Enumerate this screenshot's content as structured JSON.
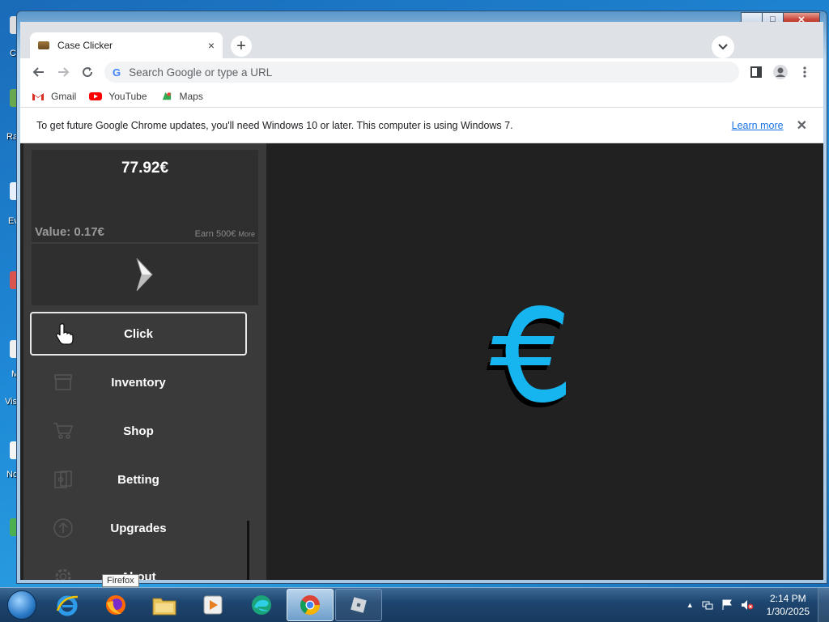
{
  "desktop": {
    "edge_labels": [
      "C",
      "Ra",
      "Ev",
      "M",
      "Vis",
      "No"
    ]
  },
  "browser": {
    "tab_title": "Case Clicker",
    "tab_close": "×",
    "new_tab": "+",
    "tab_search": "⌄",
    "omnibox_placeholder": "Search Google or type a URL",
    "bookmarks": [
      {
        "label": "Gmail",
        "color": "#d93025"
      },
      {
        "label": "YouTube",
        "color": "#ff0000"
      },
      {
        "label": "Maps",
        "color": "#34a853"
      }
    ],
    "infobar": {
      "text": "To get future Google Chrome updates, you'll need Windows 10 or later. This computer is using Windows 7.",
      "link": "Learn more",
      "close": "✕"
    },
    "window_controls": {
      "minimize": "▁",
      "maximize": "□",
      "close": "✕"
    }
  },
  "game": {
    "balance": "77.92€",
    "value_label": "Value: 0.17€",
    "earn_prefix": "Earn 500€",
    "earn_suffix": "More",
    "menu": [
      {
        "label": "Click",
        "icon": "pointer-hand-icon",
        "active": true
      },
      {
        "label": "Inventory",
        "icon": "inventory-box-icon",
        "active": false
      },
      {
        "label": "Shop",
        "icon": "shopping-cart-icon",
        "active": false
      },
      {
        "label": "Betting",
        "icon": "betting-cards-icon",
        "active": false
      },
      {
        "label": "Upgrades",
        "icon": "upgrade-arrow-icon",
        "active": false
      },
      {
        "label": "About",
        "icon": "gear-icon",
        "active": false
      }
    ],
    "euro_symbol": "€",
    "euro_color": "#17b5f0"
  },
  "tooltip": "Firefox",
  "taskbar": {
    "time": "2:14 PM",
    "date": "1/30/2025",
    "tray_up": "▲"
  }
}
